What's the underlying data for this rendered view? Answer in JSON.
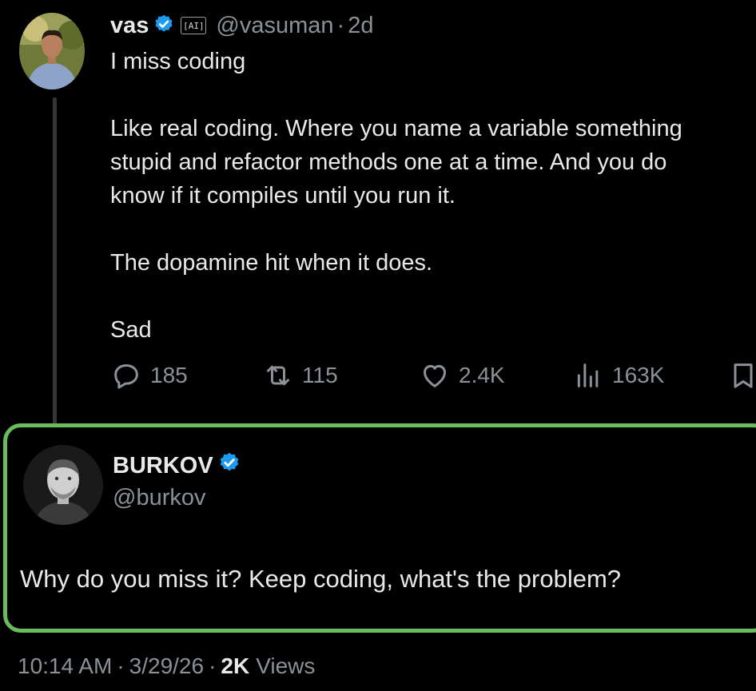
{
  "original": {
    "author_name": "vas",
    "ai_badge": "[AI]",
    "handle": "@vasuman",
    "separator": "·",
    "time": "2d",
    "lines": [
      "I miss coding",
      "",
      "Like real coding. Where you name a variable something",
      "stupid and refactor methods one at a time. And you do",
      "know if it compiles until you run it.",
      "",
      "The dopamine hit when it does.",
      "",
      "Sad"
    ],
    "replies": "185",
    "reposts": "115",
    "likes": "2.4K",
    "views": "163K",
    "icons": [
      "verified-badge-icon",
      "reply-icon",
      "repost-icon",
      "like-icon",
      "views-icon",
      "bookmark-icon"
    ]
  },
  "reply": {
    "author_name": "BURKOV",
    "handle": "@burkov",
    "text": "Why do you miss it? Keep coding, what's the problem?"
  },
  "footer": {
    "time": "10:14 AM",
    "sep1": "·",
    "date": "3/29/26",
    "sep2": "·",
    "views_count": "2K",
    "views_label": "Views"
  },
  "colors": {
    "background": "#000000",
    "text": "#e7e9ea",
    "muted": "#8b9196",
    "verified": "#1d9bf0",
    "highlight_border": "#6abb5e"
  }
}
